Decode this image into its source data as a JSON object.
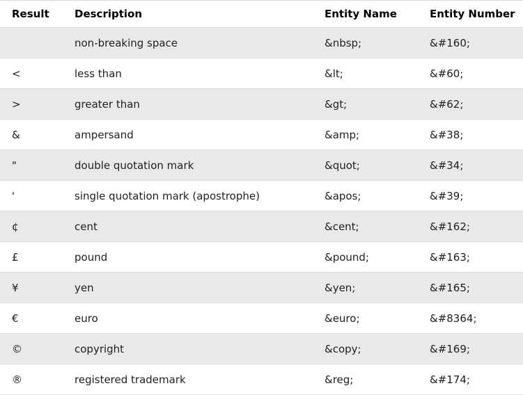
{
  "table": {
    "headers": {
      "result": "Result",
      "description": "Description",
      "entity_name": "Entity Name",
      "entity_number": "Entity Number"
    },
    "rows": [
      {
        "result": " ",
        "description": "non-breaking space",
        "entity_name": "&nbsp;",
        "entity_number": "&#160;"
      },
      {
        "result": "<",
        "description": "less than",
        "entity_name": "&lt;",
        "entity_number": "&#60;"
      },
      {
        "result": ">",
        "description": "greater than",
        "entity_name": "&gt;",
        "entity_number": "&#62;"
      },
      {
        "result": "&",
        "description": "ampersand",
        "entity_name": "&amp;",
        "entity_number": "&#38;"
      },
      {
        "result": "\"",
        "description": "double quotation mark",
        "entity_name": "&quot;",
        "entity_number": "&#34;"
      },
      {
        "result": "'",
        "description": "single quotation mark (apostrophe)",
        "entity_name": "&apos;",
        "entity_number": "&#39;"
      },
      {
        "result": "¢",
        "description": "cent",
        "entity_name": "&cent;",
        "entity_number": "&#162;"
      },
      {
        "result": "£",
        "description": "pound",
        "entity_name": "&pound;",
        "entity_number": "&#163;"
      },
      {
        "result": "¥",
        "description": "yen",
        "entity_name": "&yen;",
        "entity_number": "&#165;"
      },
      {
        "result": "€",
        "description": "euro",
        "entity_name": "&euro;",
        "entity_number": "&#8364;"
      },
      {
        "result": "©",
        "description": "copyright",
        "entity_name": "&copy;",
        "entity_number": "&#169;"
      },
      {
        "result": "®",
        "description": "registered trademark",
        "entity_name": "&reg;",
        "entity_number": "&#174;"
      }
    ],
    "colors": {
      "alt_row": "#e7e9eb",
      "row": "#ffffff",
      "border": "#dddddd"
    }
  }
}
